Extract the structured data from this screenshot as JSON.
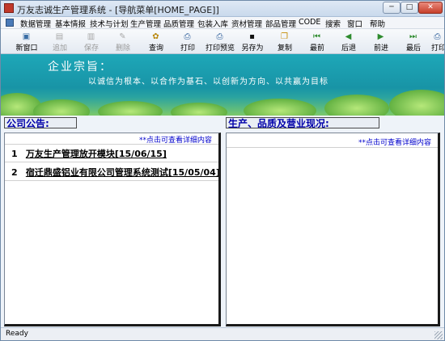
{
  "window": {
    "title": "万友志诚生产管理系统 - [导航菜单[HOME_PAGE]]",
    "minimize_label": "─",
    "maximize_label": "□",
    "close_label": "✕"
  },
  "menubar": {
    "items": [
      "数据管理",
      "基本情报",
      "技术与计划",
      "生产管理",
      "品质管理",
      "包装入库",
      "资材管理",
      "部品管理",
      "CODE",
      "搜索",
      "窗口",
      "帮助"
    ]
  },
  "toolbar": {
    "buttons": [
      {
        "label": "新窗口",
        "icon": "new-window-icon",
        "glyph": "▣",
        "enabled": true
      },
      {
        "label": "追加",
        "icon": "add-icon",
        "glyph": "▤",
        "enabled": false
      },
      {
        "label": "保存",
        "icon": "save-icon",
        "glyph": "▥",
        "enabled": false
      },
      {
        "label": "删除",
        "icon": "delete-icon",
        "glyph": "✎",
        "enabled": false
      },
      {
        "label": "查询",
        "icon": "query-icon",
        "glyph": "✿",
        "enabled": true
      },
      {
        "label": "打印",
        "icon": "print-icon",
        "glyph": "⎙",
        "enabled": true
      },
      {
        "label": "打印预览",
        "icon": "print-preview-icon",
        "glyph": "⎙",
        "enabled": true
      },
      {
        "label": "另存为",
        "icon": "save-as-icon",
        "glyph": "▪",
        "enabled": true
      },
      {
        "label": "复制",
        "icon": "copy-icon",
        "glyph": "❐",
        "enabled": true
      },
      {
        "label": "最前",
        "icon": "first-icon",
        "glyph": "⏮",
        "enabled": true
      },
      {
        "label": "后退",
        "icon": "back-icon",
        "glyph": "◀",
        "enabled": true
      },
      {
        "label": "前进",
        "icon": "forward-icon",
        "glyph": "▶",
        "enabled": true
      },
      {
        "label": "最后",
        "icon": "last-icon",
        "glyph": "⏭",
        "enabled": true
      },
      {
        "label": "打印",
        "icon": "print-icon-2",
        "glyph": "⎙",
        "enabled": true
      }
    ]
  },
  "banner": {
    "title": "企业宗旨：",
    "motto": "以诚信为根本、以合作为基石、以创新为方向、以共赢为目标"
  },
  "notices": {
    "header": "公司公告:",
    "hint": "**点击可查看详细内容",
    "items": [
      {
        "no": "1",
        "text": "万友生产管理放开模块[15/06/15]"
      },
      {
        "no": "2",
        "text": "宿迁鼎盛铝业有限公司管理系统测试[15/05/04]"
      }
    ]
  },
  "status_report": {
    "header": "生产、品质及营业现况:",
    "hint": "**点击可查看详细内容"
  },
  "statusbar": {
    "text": "Ready"
  },
  "colors": {
    "section_header_text": "#0000aa",
    "hint_text": "#0000cc",
    "banner_teal": "#1894a6",
    "close_button": "#c7402b"
  }
}
